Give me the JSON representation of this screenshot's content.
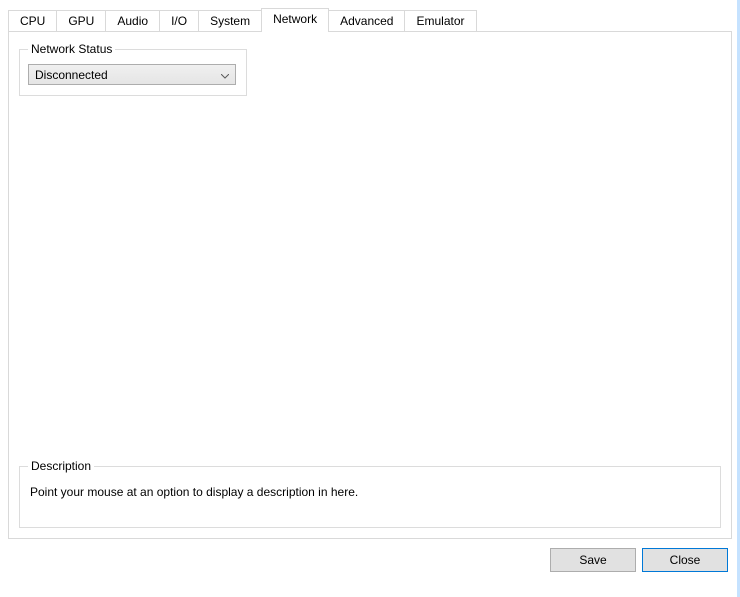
{
  "tabs": {
    "cpu": "CPU",
    "gpu": "GPU",
    "audio": "Audio",
    "io": "I/O",
    "system": "System",
    "network": "Network",
    "advanced": "Advanced",
    "emulator": "Emulator"
  },
  "network": {
    "status_group_label": "Network Status",
    "status_value": "Disconnected"
  },
  "description": {
    "group_label": "Description",
    "text": "Point your mouse at an option to display a description in here."
  },
  "buttons": {
    "save": "Save",
    "close": "Close"
  }
}
